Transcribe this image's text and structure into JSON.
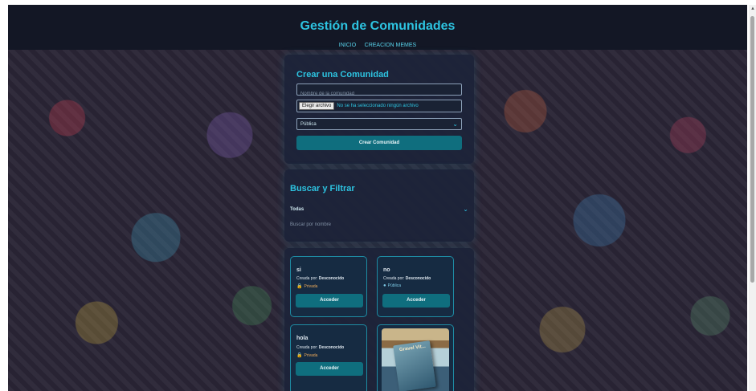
{
  "header": {
    "title": "Gestión de Comunidades",
    "nav": [
      "INICIO",
      "CREACION MEMES"
    ]
  },
  "create": {
    "title": "Crear una Comunidad",
    "name_placeholder": "Nombre de la comunidad",
    "file_button": "Elegir archivo",
    "file_status": "No se ha seleccionado ningún archivo",
    "privacy_selected": "Pública",
    "submit": "Crear Comunidad"
  },
  "search": {
    "title": "Buscar y Filtrar",
    "filter_selected": "Todas",
    "search_placeholder": "Buscar por nombre"
  },
  "communities": [
    {
      "name": "si",
      "creator_label": "Creada por:",
      "creator": "Desconocido",
      "privacy": "Privada",
      "privacy_icon": "lock-icon",
      "action": "Acceder"
    },
    {
      "name": "no",
      "creator_label": "Creada por:",
      "creator": "Desconocido",
      "privacy": "Pública",
      "privacy_icon": "globe-icon",
      "action": "Acceder"
    },
    {
      "name": "hola",
      "creator_label": "Creada por:",
      "creator": "Desconocido",
      "privacy": "Privada",
      "privacy_icon": "lock-icon",
      "action": "Acceder"
    },
    {
      "image_text": "Gravel Vit..."
    }
  ],
  "colors": {
    "accent": "#2dc3e0",
    "button": "#0f6e7e",
    "header_bg": "#131725",
    "panel_bg": "#1c243a"
  }
}
